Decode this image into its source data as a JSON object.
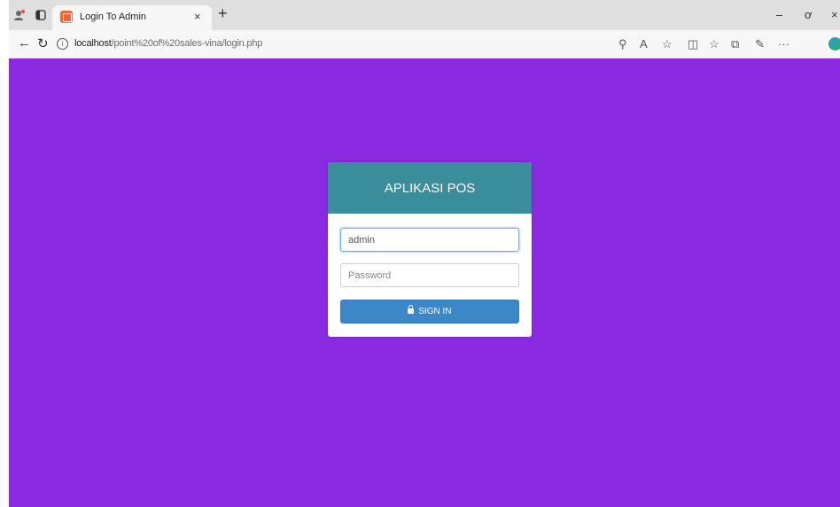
{
  "browser": {
    "tab_title": "Login To Admin",
    "tab_close": "×",
    "new_tab": "+",
    "url_host": "localhost",
    "url_path": "/point%20of%20sales-vina/login.php",
    "minimize": "–",
    "restore": "ơ",
    "close": "×",
    "more": "···",
    "accent_color": "#f0643c"
  },
  "page": {
    "background_color": "#8a2be2",
    "header_color": "#3a8d9b"
  },
  "login": {
    "title": "APLIKASI POS",
    "username_value": "admin",
    "password_placeholder": "Password",
    "signin_label": "SIGN IN",
    "signin_icon": "lock-icon"
  }
}
